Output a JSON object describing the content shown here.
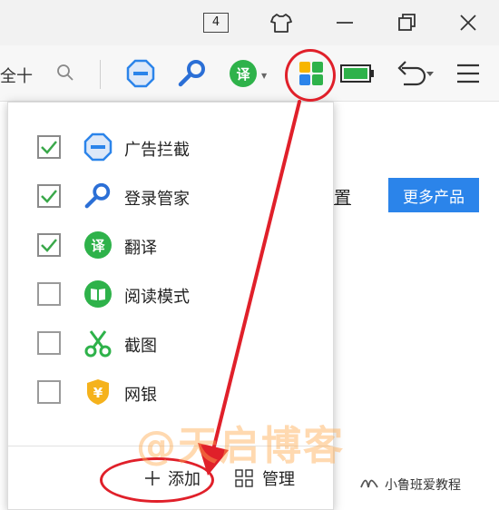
{
  "titlebar": {
    "tab_count": "4",
    "icons": [
      "shirt-icon",
      "minimize-icon",
      "restore-icon",
      "close-icon"
    ]
  },
  "toolbar": {
    "search_text": "全十",
    "icons": [
      "search-icon",
      "adblock-icon",
      "password-key-icon",
      "translate-icon",
      "apps-grid-icon",
      "battery-icon",
      "undo-icon",
      "menu-icon"
    ],
    "translate_glyph": "译"
  },
  "page": {
    "settings_text": "置",
    "more_products": "更多产品"
  },
  "panel": {
    "items": [
      {
        "label": "广告拦截",
        "checked": true,
        "icon": "adblock-icon"
      },
      {
        "label": "登录管家",
        "checked": true,
        "icon": "key-icon"
      },
      {
        "label": "翻译",
        "checked": true,
        "icon": "translate-icon",
        "glyph": "译"
      },
      {
        "label": "阅读模式",
        "checked": false,
        "icon": "reading-book-icon"
      },
      {
        "label": "截图",
        "checked": false,
        "icon": "scissors-icon"
      },
      {
        "label": "网银",
        "checked": false,
        "icon": "shield-yen-icon",
        "glyph": "¥"
      }
    ],
    "add_label": "添加",
    "manage_label": "管理"
  },
  "overlay": {
    "watermark": "@天启博客",
    "channel": "小鲁班爱教程"
  },
  "colors": {
    "accent_blue": "#2b84ea",
    "annotation_red": "#e0202a",
    "check_green": "#3aa84a",
    "translate_green": "#2eb24a"
  }
}
